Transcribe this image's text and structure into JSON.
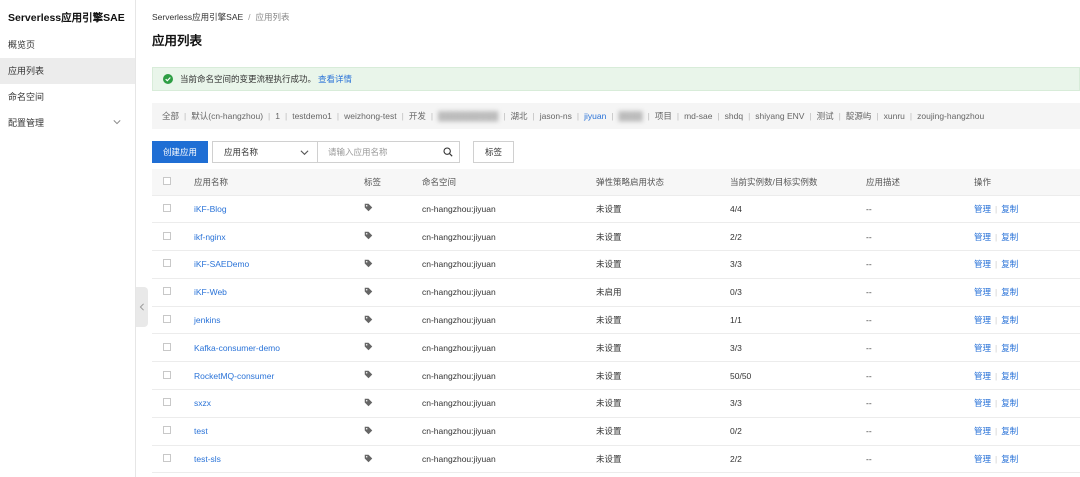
{
  "sidebar": {
    "title": "Serverless应用引擎SAE",
    "items": [
      {
        "label": "概览页"
      },
      {
        "label": "应用列表"
      },
      {
        "label": "命名空间"
      },
      {
        "label": "配置管理"
      }
    ]
  },
  "breadcrumb": {
    "root": "Serverless应用引擎SAE",
    "separator": "/",
    "current": "应用列表"
  },
  "page_title": "应用列表",
  "alert": {
    "message": "当前命名空间的变更流程执行成功。",
    "link": "查看详情"
  },
  "namespaces": [
    {
      "label": "全部"
    },
    {
      "label": "默认(cn-hangzhou)"
    },
    {
      "label": "1"
    },
    {
      "label": "testdemo1"
    },
    {
      "label": "weizhong-test"
    },
    {
      "label": "开发"
    },
    {
      "label": "██████████"
    },
    {
      "label": "湖北"
    },
    {
      "label": "jason-ns"
    },
    {
      "label": "jiyuan"
    },
    {
      "label": "████"
    },
    {
      "label": "项目"
    },
    {
      "label": "md-sae"
    },
    {
      "label": "shdq"
    },
    {
      "label": "shiyang ENV"
    },
    {
      "label": "测试"
    },
    {
      "label": "靛源屿"
    },
    {
      "label": "xunru"
    },
    {
      "label": "zoujing-hangzhou"
    }
  ],
  "toolbar": {
    "create_label": "创建应用",
    "filter_select": "应用名称",
    "search_placeholder": "请输入应用名称",
    "tag_button": "标签"
  },
  "table": {
    "headers": {
      "name": "应用名称",
      "tag": "标签",
      "namespace": "命名空间",
      "elastic": "弹性策略启用状态",
      "instances": "当前实例数/目标实例数",
      "desc": "应用描述",
      "ops": "操作"
    },
    "op_manage": "管理",
    "op_copy": "复制",
    "rows": [
      {
        "name": "iKF-Blog",
        "namespace": "cn-hangzhou:jiyuan",
        "elastic": "未设置",
        "instances": "4/4",
        "desc": "--"
      },
      {
        "name": "ikf-nginx",
        "namespace": "cn-hangzhou:jiyuan",
        "elastic": "未设置",
        "instances": "2/2",
        "desc": "--"
      },
      {
        "name": "iKF-SAEDemo",
        "namespace": "cn-hangzhou:jiyuan",
        "elastic": "未设置",
        "instances": "3/3",
        "desc": "--"
      },
      {
        "name": "iKF-Web",
        "namespace": "cn-hangzhou:jiyuan",
        "elastic": "未启用",
        "instances": "0/3",
        "desc": "--"
      },
      {
        "name": "jenkins",
        "namespace": "cn-hangzhou:jiyuan",
        "elastic": "未设置",
        "instances": "1/1",
        "desc": "--"
      },
      {
        "name": "Kafka-consumer-demo",
        "namespace": "cn-hangzhou:jiyuan",
        "elastic": "未设置",
        "instances": "3/3",
        "desc": "--"
      },
      {
        "name": "RocketMQ-consumer",
        "namespace": "cn-hangzhou:jiyuan",
        "elastic": "未设置",
        "instances": "50/50",
        "desc": "--"
      },
      {
        "name": "sxzx",
        "namespace": "cn-hangzhou:jiyuan",
        "elastic": "未设置",
        "instances": "3/3",
        "desc": "--"
      },
      {
        "name": "test",
        "namespace": "cn-hangzhou:jiyuan",
        "elastic": "未设置",
        "instances": "0/2",
        "desc": "--"
      },
      {
        "name": "test-sls",
        "namespace": "cn-hangzhou:jiyuan",
        "elastic": "未设置",
        "instances": "2/2",
        "desc": "--"
      }
    ]
  },
  "colors": {
    "primary": "#1f6ed4",
    "link": "#2a73d8",
    "success": "#2e9e44",
    "alert_bg": "#e9f5ea"
  }
}
